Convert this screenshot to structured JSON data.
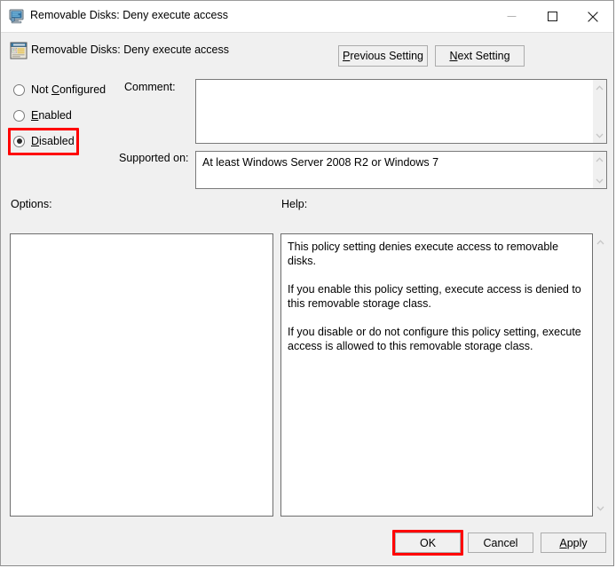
{
  "window": {
    "title": "Removable Disks: Deny execute access",
    "title_icon": "computer-monitor-icon",
    "controls": {
      "minimize": "minimize-icon",
      "maximize": "maximize-icon",
      "close": "close-icon"
    }
  },
  "header": {
    "icon": "policy-setting-icon",
    "title": "Removable Disks: Deny execute access",
    "previous_setting": "Previous Setting",
    "next_setting": "Next Setting",
    "previous_accel": "P",
    "next_accel": "N"
  },
  "state_options": [
    {
      "label": "Not Configured",
      "accel": "C",
      "selected": false,
      "highlighted": false
    },
    {
      "label": "Enabled",
      "accel": "E",
      "selected": false,
      "highlighted": false
    },
    {
      "label": "Disabled",
      "accel": "D",
      "selected": true,
      "highlighted": true
    }
  ],
  "comment": {
    "label": "Comment:",
    "value": ""
  },
  "supported_on": {
    "label": "Supported on:",
    "value": "At least Windows Server 2008 R2 or Windows 7"
  },
  "options": {
    "label": "Options:"
  },
  "help": {
    "label": "Help:",
    "paragraphs": [
      "This policy setting denies execute access to removable disks.",
      "If you enable this policy setting, execute access is denied to this removable storage class.",
      "If you disable or do not configure this policy setting, execute access is allowed to this removable storage class."
    ]
  },
  "footer": {
    "ok": "OK",
    "cancel": "Cancel",
    "apply": "Apply",
    "apply_accel": "A"
  },
  "annotations": {
    "color": "#ff0000",
    "targets": [
      "Disabled",
      "OK"
    ]
  }
}
